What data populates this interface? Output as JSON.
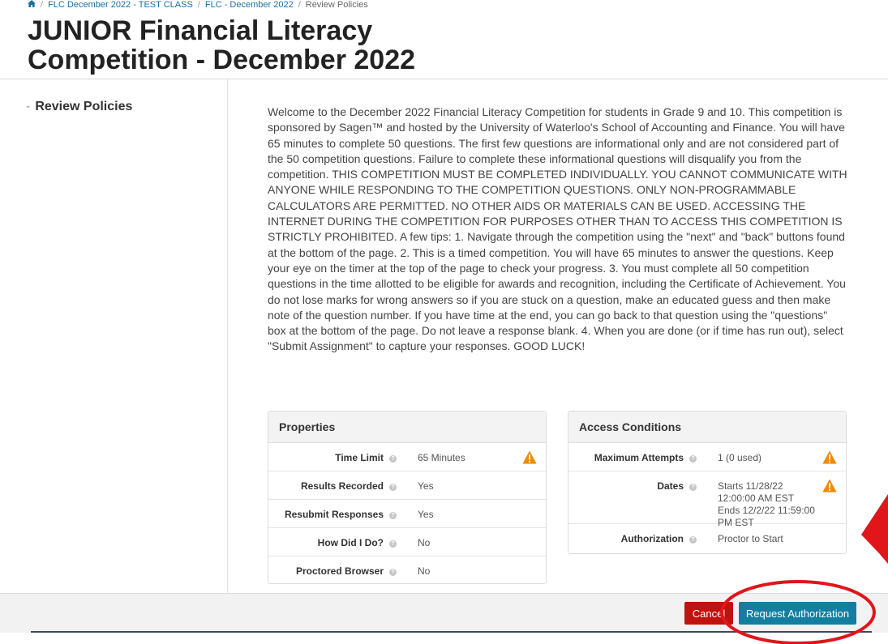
{
  "breadcrumb": {
    "items": [
      "FLC December 2022 - TEST CLASS",
      "FLC - December 2022",
      "Review Policies"
    ]
  },
  "page": {
    "title": "JUNIOR Financial Literacy Competition - December 2022"
  },
  "sidebar": {
    "item_label": "Review Policies"
  },
  "instructions": "Welcome to the December 2022 Financial Literacy Competition for students in Grade 9 and 10. This competition is sponsored by Sagen™ and hosted by the University of Waterloo's School of Accounting and Finance. You will have 65 minutes to complete 50 questions. The first few questions are informational only and are not considered part of the 50 competition questions. Failure to complete these informational questions will disqualify you from the competition. THIS COMPETITION MUST BE COMPLETED INDIVIDUALLY. YOU CANNOT COMMUNICATE WITH ANYONE WHILE RESPONDING TO THE COMPETITION QUESTIONS. ONLY NON-PROGRAMMABLE CALCULATORS ARE PERMITTED. NO OTHER AIDS OR MATERIALS CAN BE USED. ACCESSING THE INTERNET DURING THE COMPETITION FOR PURPOSES OTHER THAN TO ACCESS THIS COMPETITION IS STRICTLY PROHIBITED. A few tips: 1. Navigate through the competition using the \"next\" and \"back\" buttons found at the bottom of the page. 2. This is a timed competition. You will have 65 minutes to answer the questions. Keep your eye on the timer at the top of the page to check your progress. 3. You must complete all 50 competition questions in the time allotted to be eligible for awards and recognition, including the Certificate of Achievement. You do not lose marks for wrong answers so if you are stuck on a question, make an educated guess and then make note of the question number. If you have time at the end, you can go back to that question using the \"questions\" box at the bottom of the page. Do not leave a response blank. 4. When you are done (or if time has run out), select \"Submit Assignment\" to capture your responses. GOOD LUCK!",
  "properties": {
    "title": "Properties",
    "rows": [
      {
        "label": "Time Limit",
        "value": "65 Minutes",
        "warning": true
      },
      {
        "label": "Results Recorded",
        "value": "Yes",
        "warning": false
      },
      {
        "label": "Resubmit Responses",
        "value": "Yes",
        "warning": false
      },
      {
        "label": "How Did I Do?",
        "value": "No",
        "warning": false
      },
      {
        "label": "Proctored Browser",
        "value": "No",
        "warning": false
      }
    ]
  },
  "access": {
    "title": "Access Conditions",
    "rows": [
      {
        "label": "Maximum Attempts",
        "value": "1 (0 used)",
        "warning": true
      },
      {
        "label": "Dates",
        "value": "Starts 11/28/22 12:00:00 AM EST Ends 12/2/22 11:59:00 PM EST",
        "warning": true
      },
      {
        "label": "Authorization",
        "value": "Proctor to Start",
        "warning": false
      }
    ]
  },
  "footer": {
    "cancel_label": "Cancel",
    "request_label": "Request Authorization"
  },
  "icons": {
    "help": "help-circle-icon",
    "warning": "warning-triangle-icon",
    "home": "home-icon"
  },
  "colors": {
    "cancel": "#c0120f",
    "primary": "#137fa0",
    "warning": "#f08a00",
    "annotation": "#e0161b"
  }
}
